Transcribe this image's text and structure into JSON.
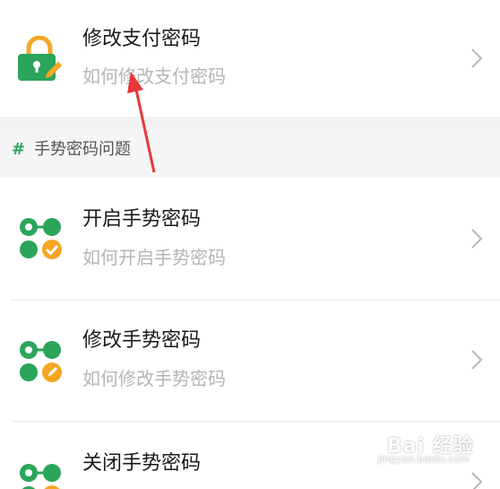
{
  "items": [
    {
      "title": "修改支付密码",
      "subtitle": "如何修改支付密码",
      "icon": "lock-edit-icon"
    },
    {
      "title": "开启手势密码",
      "subtitle": "如何开启手势密码",
      "icon": "gesture-check-icon"
    },
    {
      "title": "修改手势密码",
      "subtitle": "如何修改手势密码",
      "icon": "gesture-edit-icon"
    },
    {
      "title": "关闭手势密码",
      "subtitle": "",
      "icon": "gesture-close-icon"
    }
  ],
  "section": {
    "hash": "#",
    "title": "手势密码问题"
  },
  "watermark": {
    "brand": "Bai 经验",
    "url": "jingyan.baidu.com"
  },
  "colors": {
    "green": "#2aa55a",
    "orange": "#f5a623",
    "subtitle_gray": "#b5b5b5",
    "annotation_red": "#e8383a"
  }
}
